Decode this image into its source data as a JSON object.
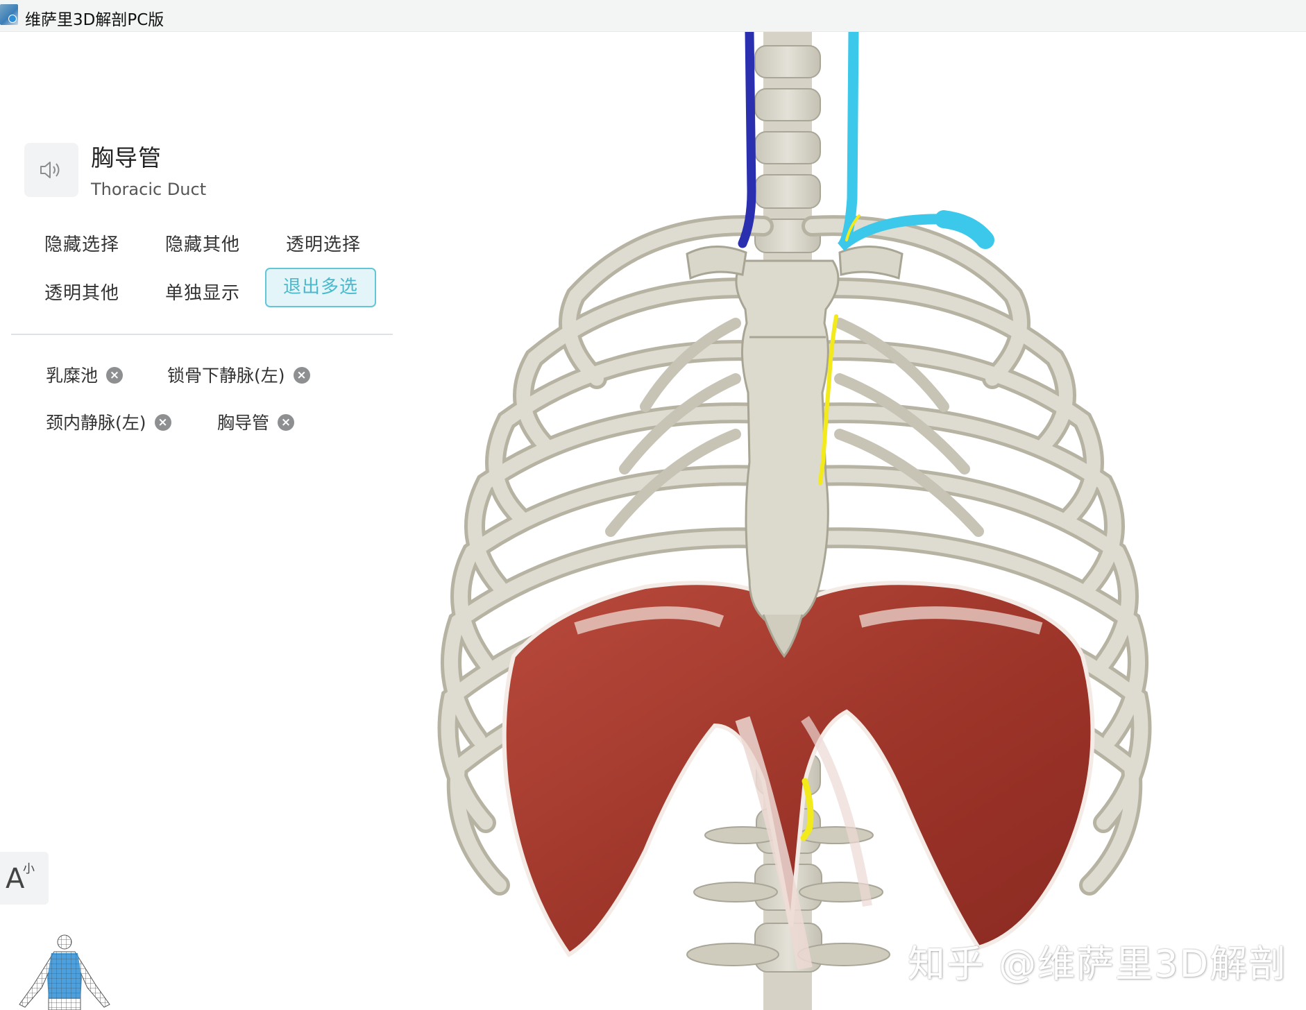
{
  "window": {
    "title": "维萨里3D解剖PC版",
    "icon": "vesalius-app-icon"
  },
  "selection": {
    "name_cn": "胸导管",
    "name_en": "Thoracic Duct",
    "speaker_icon": "speaker-icon"
  },
  "actions": {
    "hide_selected": "隐藏选择",
    "hide_others": "隐藏其他",
    "transparent_selected": "透明选择",
    "transparent_others": "透明其他",
    "show_only": "单独显示",
    "exit_multiselect": "退出多选"
  },
  "selected_items": [
    {
      "label": "乳糜池"
    },
    {
      "label": "锁骨下静脉(左)"
    },
    {
      "label": "颈内静脉(左)"
    },
    {
      "label": "胸导管"
    }
  ],
  "font_button": {
    "big": "A",
    "small": "小"
  },
  "watermark": "知乎 @维萨里3D解剖",
  "colors": {
    "accent": "#4bb8cc",
    "bone": "#d9d6cb",
    "muscle": "#a83b2f",
    "vein_dark": "#2a2fb0",
    "vein_light": "#3cc8ea",
    "duct": "#f2ea1a"
  }
}
